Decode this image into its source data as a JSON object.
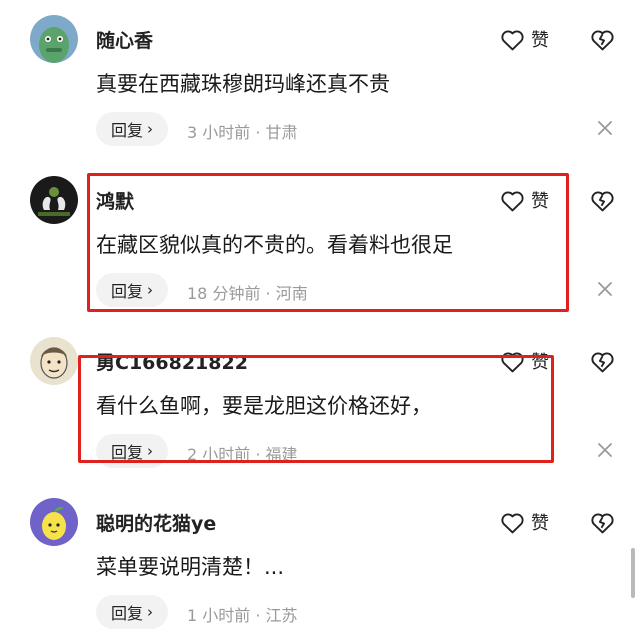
{
  "comments": [
    {
      "username": "随心香",
      "text": "真要在西藏珠穆朗玛峰还真不贵",
      "reply_label": "回复",
      "meta": "3 小时前 · 甘肃",
      "like_label": "赞"
    },
    {
      "username": "鸿默",
      "text": "在藏区貌似真的不贵的。看着料也很足",
      "reply_label": "回复",
      "meta": "18 分钟前 · 河南",
      "like_label": "赞"
    },
    {
      "username": "勇C166821822",
      "text": "看什么鱼啊，要是龙胆这价格还好，",
      "reply_label": "回复",
      "meta": "2 小时前 · 福建",
      "like_label": "赞"
    },
    {
      "username": "聪明的花猫ye",
      "text": "菜单要说明清楚！...",
      "reply_label": "回复",
      "meta": "1 小时前 · 江苏",
      "like_label": "赞"
    }
  ],
  "icons": {
    "like": "heart-outline-icon",
    "dislike": "broken-heart-icon",
    "close": "close-icon",
    "chevron": "chevron-right-icon"
  },
  "colors": {
    "highlight": "#e0201c",
    "meta": "#9a9a9a",
    "reply_bg": "#f2f2f2"
  }
}
